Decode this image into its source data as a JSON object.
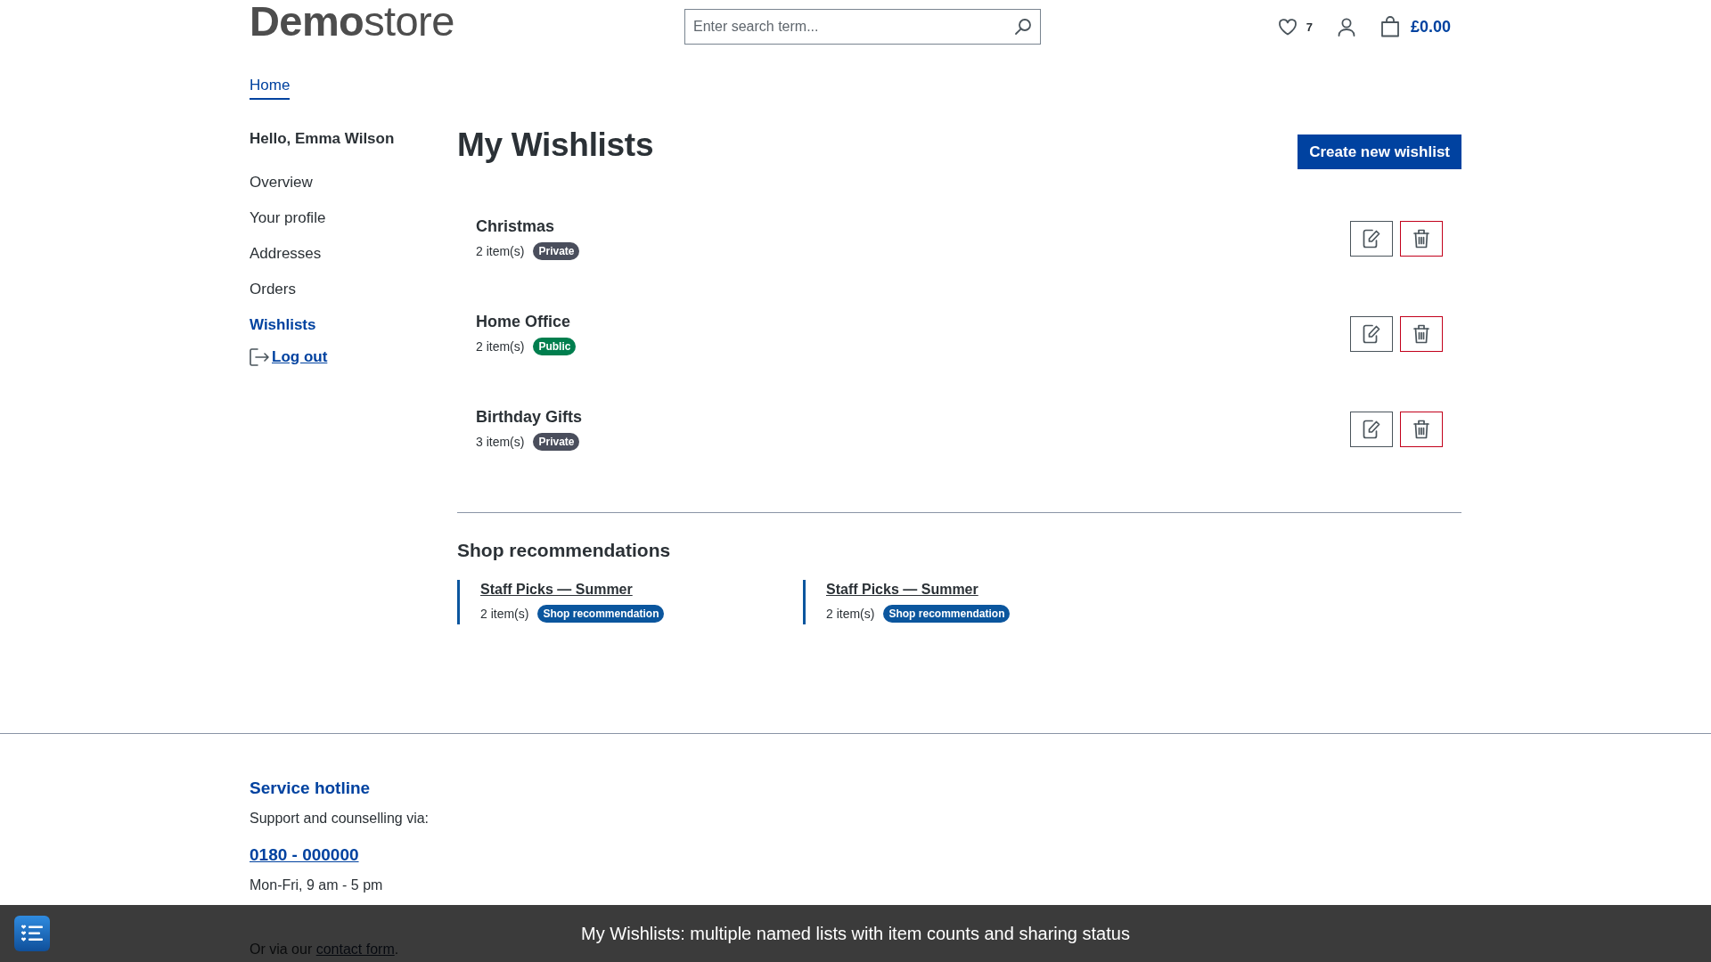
{
  "header": {
    "logo": "**Demo**store",
    "search": {
      "placeholder": "Enter search term..."
    },
    "wishlist_count": "7",
    "cart_total": "£0.00"
  },
  "breadcrumb": [
    {
      "label": "Home"
    }
  ],
  "sidebar": {
    "greeting": "Hello, Emma Wilson",
    "items": [
      {
        "label": "Overview",
        "selected": false
      },
      {
        "label": "Your profile",
        "selected": false
      },
      {
        "label": "Addresses",
        "selected": false
      },
      {
        "label": "Orders",
        "selected": false
      },
      {
        "label": "Wishlists",
        "selected": true
      }
    ],
    "logout": "Log out"
  },
  "main": {
    "title": "My Wishlists",
    "create_button": "Create new wishlist",
    "wishlists": [
      {
        "name": "Christmas",
        "count": "2 item(s)",
        "visibility": {
          "kind": "private",
          "label": "Private"
        }
      },
      {
        "name": "Home Office",
        "count": "2 item(s)",
        "visibility": {
          "kind": "public",
          "label": "Public"
        }
      },
      {
        "name": "Birthday Gifts",
        "count": "3 item(s)",
        "visibility": {
          "kind": "private",
          "label": "Private"
        }
      }
    ]
  },
  "recommendations": {
    "title": "Shop recommendations",
    "items": [
      {
        "name": "Staff Picks — Summer",
        "count": "2 item(s)",
        "badge": "Shop recommendation"
      },
      {
        "name": "Staff Picks — Summer",
        "count": "2 item(s)",
        "badge": "Shop recommendation"
      }
    ]
  },
  "footer": {
    "title": "Service hotline",
    "text": "Support and counselling via:",
    "phone": "0180 - 000000",
    "hours": "Mon-Fri, 9 am - 5 pm",
    "contact": {
      "prefix": "Or via our ",
      "link": "contact form",
      "suffix": "."
    }
  },
  "caption_bar": {
    "text": "My Wishlists: multiple named lists with item counts and sharing status"
  }
}
